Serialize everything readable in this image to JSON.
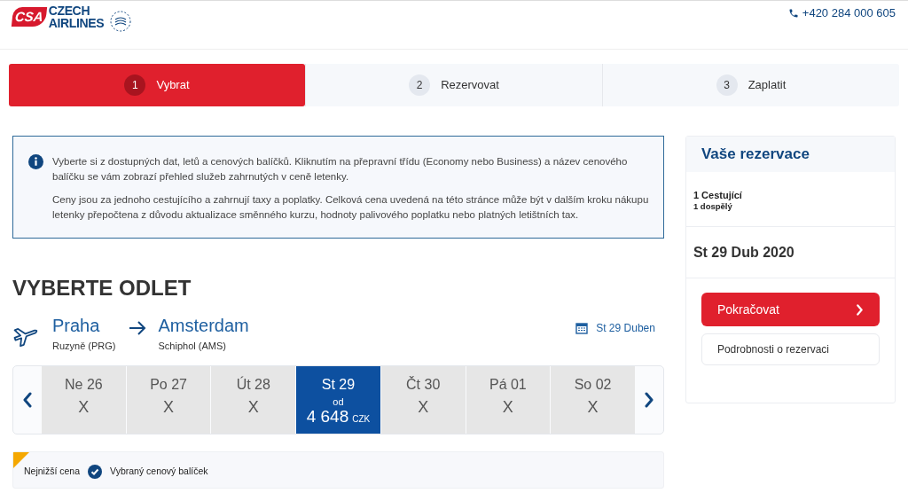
{
  "header": {
    "logo": {
      "mark": "CSA",
      "line_1": "CZECH",
      "line_2": "AIRLINES"
    },
    "phone": "+420 284 000 605"
  },
  "steps": [
    {
      "number": "1",
      "label": "Vybrat",
      "selected": true
    },
    {
      "number": "2",
      "label": "Rezervovat",
      "selected": false
    },
    {
      "number": "3",
      "label": "Zaplatit",
      "selected": false
    }
  ],
  "info": [
    "Vyberte si z dostupných dat, letů a cenových balíčků. Kliknutím na přepravní třídu (Economy nebo Business) a název cenového balíčku se vám zobrazí přehled služeb zahrnutých v ceně letenky.",
    "Ceny jsou za jednoho cestujícího a zahrnují taxy a poplatky. Celková cena uvedená na této stránce může být v dalším kroku nákupu letenky přepočtena z důvodu aktualizace směnného kurzu, hodnoty palivového poplatku nebo platných letištních tax."
  ],
  "heading": "VYBERTE ODLET",
  "route": {
    "from_city": "Praha",
    "from_airport": "Ruzyně (PRG)",
    "to_city": "Amsterdam",
    "to_airport": "Schiphol (AMS)",
    "date": "St 29 Duben"
  },
  "dates": [
    {
      "label": "Ne 26",
      "price": "X",
      "selected": false
    },
    {
      "label": "Po 27",
      "price": "X",
      "selected": false
    },
    {
      "label": "Út 28",
      "price": "X",
      "selected": false
    },
    {
      "label": "St 29",
      "prefix": "od",
      "price": "4 648",
      "currency": "CZK",
      "selected": true
    },
    {
      "label": "Čt 30",
      "price": "X",
      "selected": false
    },
    {
      "label": "Pá 01",
      "price": "X",
      "selected": false
    },
    {
      "label": "So 02",
      "price": "X",
      "selected": false
    }
  ],
  "legend": {
    "lowest": "Nejnižší cena",
    "selected_package": "Vybraný cenový balíček"
  },
  "summary": {
    "title": "Vaše rezervace",
    "passengers": "1 Cestující",
    "passenger_detail": "1 dospělý",
    "date": "St 29 Dub 2020",
    "continue": "Pokračovat",
    "details": "Podrobnosti o rezervaci"
  }
}
